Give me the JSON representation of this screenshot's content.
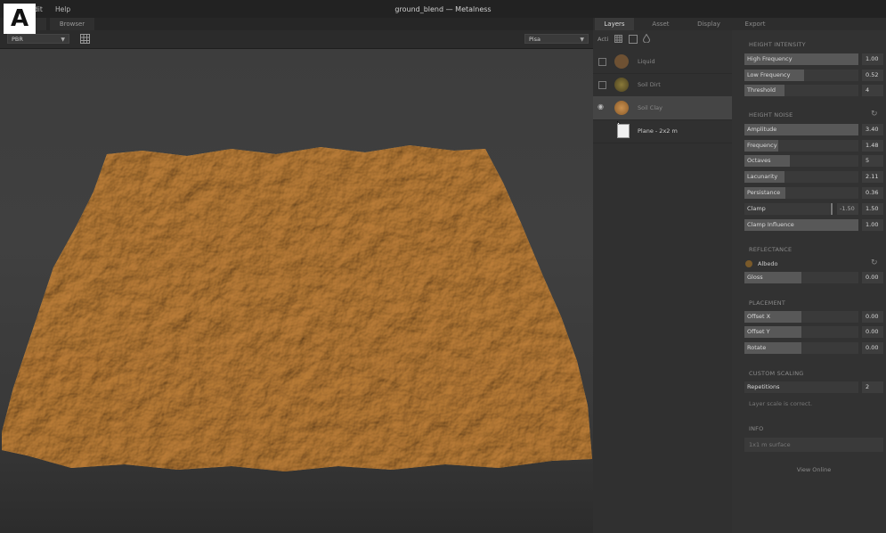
{
  "window": {
    "title": "ground_blend — Metalness"
  },
  "menu": {
    "edit": "dit",
    "help": "Help"
  },
  "left_tabs": [
    "",
    "Browser"
  ],
  "viewport_toolbar": {
    "shading_mode": "PBR",
    "environment": "Pisa"
  },
  "right_tabs": [
    "Layers",
    "Asset",
    "Display",
    "Export"
  ],
  "layers_toolbar": {
    "label": "Acti"
  },
  "layers": [
    {
      "name": "Liquid",
      "color": "#7a5a3a"
    },
    {
      "name": "Soil Dirt",
      "color": "#6a5a2a"
    },
    {
      "name": "Soil Clay",
      "color": "#a0723a"
    },
    {
      "name": "Plane - 2x2 m",
      "color": "#dddddd"
    }
  ],
  "properties": {
    "height_intensity": {
      "title": "HEIGHT INTENSITY",
      "rows": [
        {
          "label": "High Frequency",
          "value": "1.00",
          "fill": 1.0
        },
        {
          "label": "Low Frequency",
          "value": "0.52",
          "fill": 0.52
        },
        {
          "label": "Threshold",
          "value": "4",
          "fill": 0.35
        }
      ]
    },
    "height_noise": {
      "title": "HEIGHT NOISE",
      "rows": [
        {
          "label": "Amplitude",
          "value": "3.40",
          "fill": 1.0
        },
        {
          "label": "Frequency",
          "value": "1.48",
          "fill": 0.3
        },
        {
          "label": "Octaves",
          "value": "5",
          "fill": 0.4
        },
        {
          "label": "Lacunarity",
          "value": "2.11",
          "fill": 0.35
        },
        {
          "label": "Persistance",
          "value": "0.36",
          "fill": 0.36
        }
      ],
      "clamp": {
        "label": "Clamp",
        "min": "-1.50",
        "max": "1.50"
      },
      "clamp_influence": {
        "label": "Clamp Influence",
        "value": "1.00",
        "fill": 1.0
      }
    },
    "reflectance": {
      "title": "REFLECTANCE",
      "albedo": "Albedo",
      "albedo_color": "#7a5a2a",
      "gloss": {
        "label": "Gloss",
        "value": "0.00",
        "fill": 0.5
      }
    },
    "placement": {
      "title": "PLACEMENT",
      "rows": [
        {
          "label": "Offset X",
          "value": "0.00",
          "fill": 0.5
        },
        {
          "label": "Offset Y",
          "value": "0.00",
          "fill": 0.5
        },
        {
          "label": "Rotate",
          "value": "0.00",
          "fill": 0.5
        }
      ]
    },
    "custom_scaling": {
      "title": "CUSTOM SCALING",
      "repetitions": {
        "label": "Repetitions",
        "value": "2"
      },
      "note": "Layer scale is correct."
    },
    "info": {
      "title": "INFO",
      "text": "1x1 m surface"
    },
    "view_online": "View Online"
  }
}
